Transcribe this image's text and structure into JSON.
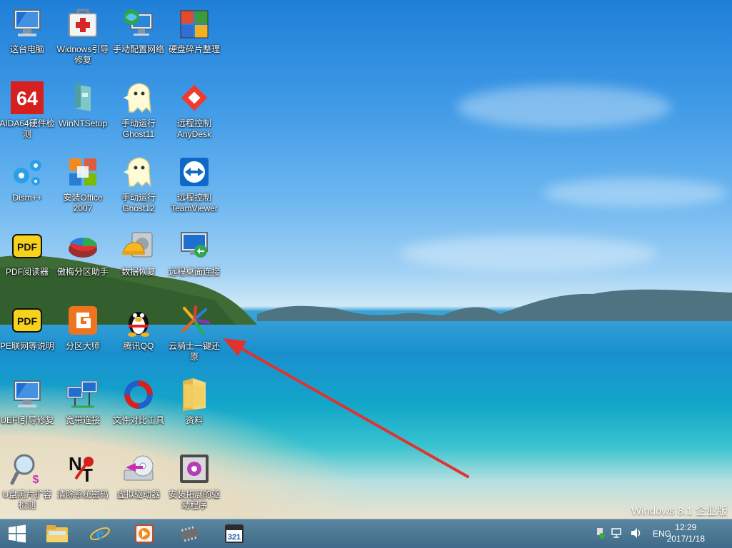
{
  "desktop_icons": [
    {
      "name": "this-pc",
      "label": "这台电脑",
      "icon": "computer-icon"
    },
    {
      "name": "windows-boot-repair",
      "label": "Widnows引导修复",
      "icon": "first-aid-kit-icon"
    },
    {
      "name": "manual-network-config",
      "label": "手动配置网络",
      "icon": "network-globe-icon"
    },
    {
      "name": "disk-defrag",
      "label": "硬盘碎片整理",
      "icon": "defrag-cubes-icon"
    },
    {
      "name": "aida64",
      "label": "AIDA64硬件检测",
      "icon": "aida64-icon"
    },
    {
      "name": "winntsetup",
      "label": "WinNTSetup",
      "icon": "winntsetup-icon"
    },
    {
      "name": "ghost11",
      "label": "手动运行Ghost11",
      "icon": "ghost-icon"
    },
    {
      "name": "anydesk",
      "label": "远程控制AnyDesk",
      "icon": "anydesk-icon"
    },
    {
      "name": "dism",
      "label": "Dism++",
      "icon": "gears-icon"
    },
    {
      "name": "office2007",
      "label": "安装Office 2007",
      "icon": "office-icon"
    },
    {
      "name": "ghost12",
      "label": "手动运行Ghost12",
      "icon": "ghost-icon"
    },
    {
      "name": "teamviewer",
      "label": "远程控制TeamViewer",
      "icon": "teamviewer-icon"
    },
    {
      "name": "pdf-reader",
      "label": "PDF阅读器",
      "icon": "pdf-icon"
    },
    {
      "name": "partition-assistant",
      "label": "傲梅分区助手",
      "icon": "pie-disk-icon"
    },
    {
      "name": "data-recovery",
      "label": "数据恢复",
      "icon": "hard-hat-disk-icon"
    },
    {
      "name": "remote-desktop",
      "label": "远程桌面连接",
      "icon": "remote-desktop-icon"
    },
    {
      "name": "pe-network-help",
      "label": "PE联网等说明",
      "icon": "pdf-icon"
    },
    {
      "name": "diskgenius",
      "label": "分区大师",
      "icon": "diskgenius-icon"
    },
    {
      "name": "tencent-qq",
      "label": "腾讯QQ",
      "icon": "qq-penguin-icon"
    },
    {
      "name": "yunqishi-restore",
      "label": "云骑士一键还原",
      "icon": "yunqishi-icon"
    },
    {
      "name": "uefi-boot-repair",
      "label": "UEFI引导修复",
      "icon": "computer-icon"
    },
    {
      "name": "broadband-connect",
      "label": "宽带连接",
      "icon": "network-computers-icon"
    },
    {
      "name": "file-compare",
      "label": "文件对比工具",
      "icon": "refresh-circle-icon"
    },
    {
      "name": "materials-folder",
      "label": "资料",
      "icon": "folder-icon"
    },
    {
      "name": "usb-capacity-check",
      "label": "U盘黑片扩容检测",
      "icon": "magnifier-icon"
    },
    {
      "name": "clear-password",
      "label": "清除系统密码",
      "icon": "nt-key-icon"
    },
    {
      "name": "virtual-drive",
      "label": "虚拟驱动器",
      "icon": "cd-drive-icon"
    },
    {
      "name": "install-ext-driver",
      "label": "安装拓展的驱动程序",
      "icon": "driver-install-icon"
    }
  ],
  "os_label": "Windows 8.1 企业版",
  "taskbar": {
    "buttons": [
      {
        "name": "start",
        "icon": "windows-logo-icon"
      },
      {
        "name": "file-explorer",
        "icon": "folder-explorer-icon"
      },
      {
        "name": "internet-explorer",
        "icon": "ie-icon"
      },
      {
        "name": "media-player",
        "icon": "play-icon"
      },
      {
        "name": "chip-tool",
        "icon": "chip-icon"
      },
      {
        "name": "calendar-321",
        "icon": "321-icon",
        "text": "321"
      }
    ],
    "tray": {
      "lang": "ENG",
      "time": "12:29",
      "date": "2017/1/18"
    }
  },
  "colors": {
    "taskbar": "#4a7894",
    "accent_arrow": "#e0322e"
  }
}
